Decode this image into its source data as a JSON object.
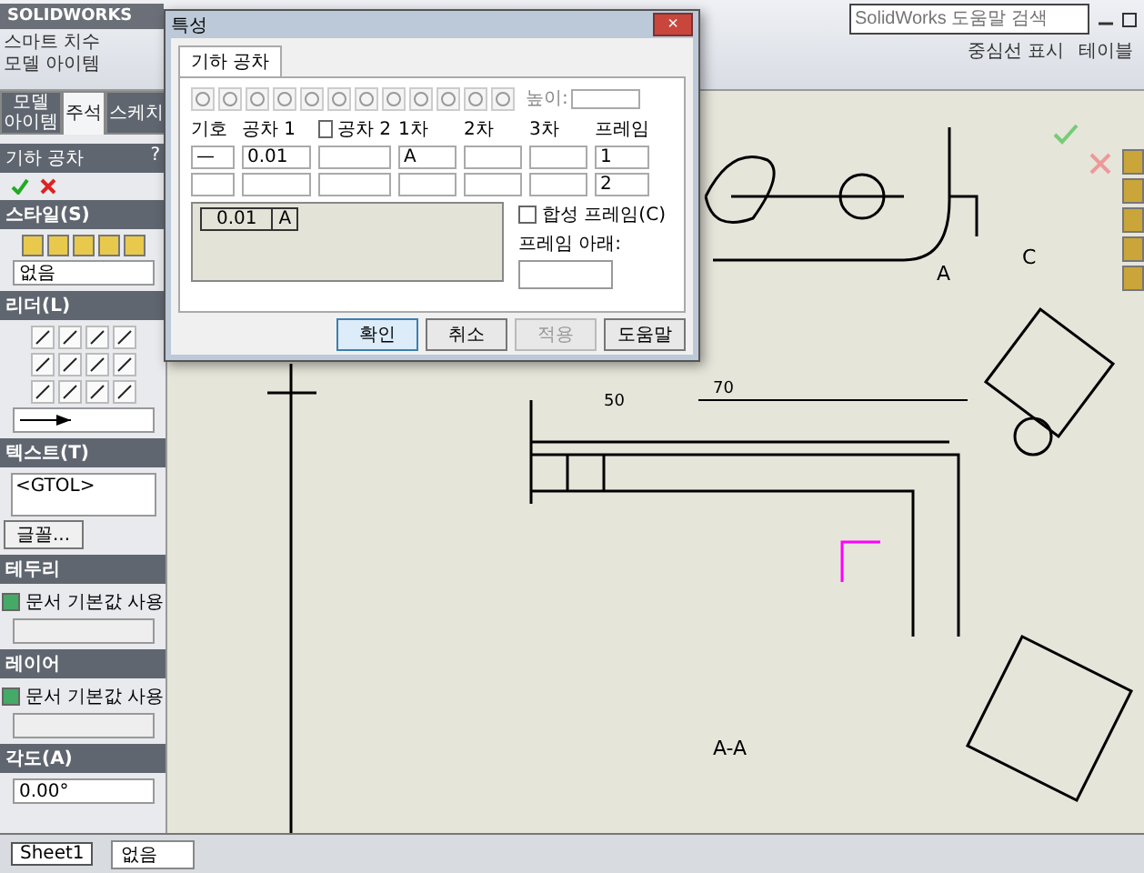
{
  "app": {
    "title": "SOLIDWORKS",
    "search_placeholder": "SolidWorks 도움말 검색"
  },
  "ribbon": [
    {
      "label": "스마트 치수"
    },
    {
      "label": "모델 아이템"
    }
  ],
  "ribbon_right": [
    {
      "label": "중심선 표시"
    },
    {
      "label": "테이블"
    }
  ],
  "tabs": [
    {
      "label": "모델 아이템",
      "selected": false
    },
    {
      "label": "주석",
      "selected": true
    },
    {
      "label": "스케치",
      "selected": false
    }
  ],
  "property_manager": {
    "title": "기하 공차",
    "help": "?",
    "style": {
      "title": "스타일(S)",
      "value": "없음"
    },
    "leader": {
      "title": "리더(L)"
    },
    "text": {
      "title": "텍스트(T)",
      "value": "<GTOL>",
      "button": "글꼴..."
    },
    "borders": [
      {
        "title": "테두리",
        "check_label": "문서 기본값 사용",
        "checked": true
      },
      {
        "title": "레이어",
        "check_label": "문서 기본값 사용",
        "checked": true
      }
    ],
    "angle": {
      "title": "각도(A)",
      "value": "0.00°"
    }
  },
  "dialog": {
    "title": "특성",
    "close": "×",
    "tab": "기하 공차",
    "height_label": "높이:",
    "columns": [
      "기호",
      "공차 1",
      "공차 2",
      "1차",
      "2차",
      "3차",
      "프레임"
    ],
    "tol2_checked": false,
    "rows": [
      {
        "symbol": "—",
        "tol1": "0.01",
        "tol2": "",
        "primary": "A",
        "secondary": "",
        "tertiary": "",
        "frame": "1"
      },
      {
        "symbol": "",
        "tol1": "",
        "tol2": "",
        "primary": "",
        "secondary": "",
        "tertiary": "",
        "frame": "2"
      }
    ],
    "preview": {
      "value": "0.01",
      "datum": "A"
    },
    "composite": {
      "label": "합성 프레임(C)",
      "checked": false
    },
    "below_label": "프레임 아래:",
    "buttons": [
      {
        "label": "확인",
        "kind": "default"
      },
      {
        "label": "취소",
        "kind": "normal"
      },
      {
        "label": "적용",
        "kind": "disabled"
      },
      {
        "label": "도움말",
        "kind": "normal"
      }
    ]
  },
  "drawing": {
    "view_label": "C",
    "datum_label": "A",
    "section_label": "A-A",
    "dims": [
      "70",
      "50"
    ]
  },
  "status": {
    "layer": "없음",
    "sheet_tab": "Sheet1"
  }
}
